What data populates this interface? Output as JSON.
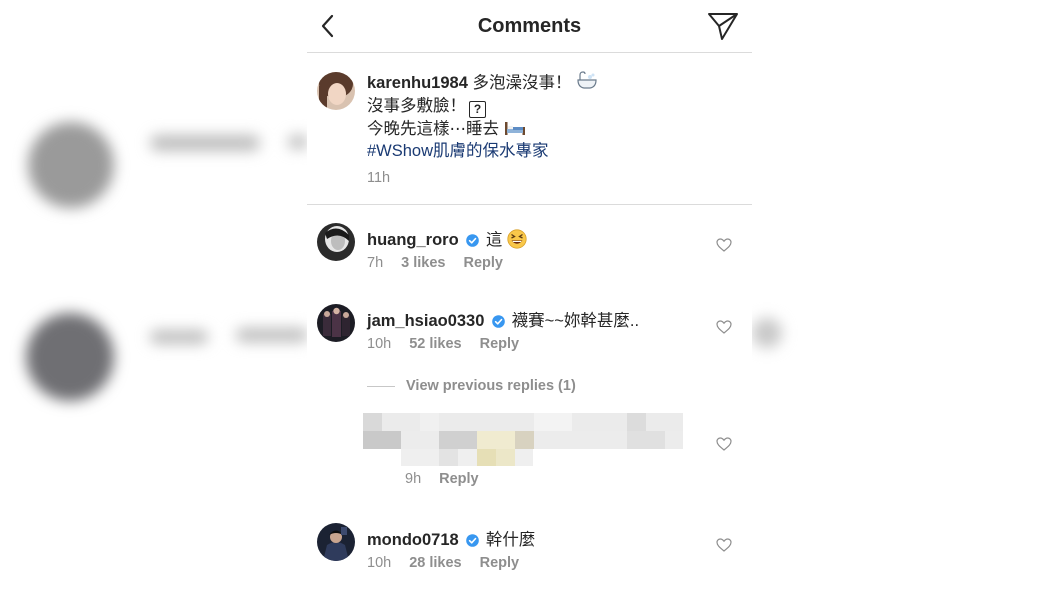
{
  "header": {
    "title": "Comments"
  },
  "caption": {
    "username": "karenhu1984",
    "lines": [
      "多泡澡沒事！",
      "沒事多敷臉！",
      "今晚先這樣⋯睡去",
      "#WShow肌膚的保水專家"
    ],
    "missing_glyph": "?",
    "time": "11h"
  },
  "comments": [
    {
      "username": "huang_roro",
      "verified": true,
      "text": "這",
      "time": "7h",
      "likes": "3 likes",
      "reply": "Reply"
    },
    {
      "username": "jam_hsiao0330",
      "verified": true,
      "text": "襪賽~~妳幹甚麼..",
      "time": "10h",
      "likes": "52 likes",
      "reply": "Reply"
    },
    {
      "username": "mondo0718",
      "verified": true,
      "text": "幹什麼",
      "time": "10h",
      "likes": "28 likes",
      "reply": "Reply"
    }
  ],
  "view_previous": "View previous replies (1)",
  "hidden_reply": {
    "time": "9h",
    "reply": "Reply"
  },
  "colors": {
    "text": "#262626",
    "muted": "#8e8e8e",
    "hashtag": "#1a3a73",
    "verified": "#3897f0",
    "divider": "#dbdbdb"
  },
  "icons": [
    "chevron-left-icon",
    "send-icon",
    "heart-outline-icon",
    "verified-badge-icon",
    "bathtub-emoji",
    "bed-emoji",
    "grinning-squint-emoji"
  ]
}
